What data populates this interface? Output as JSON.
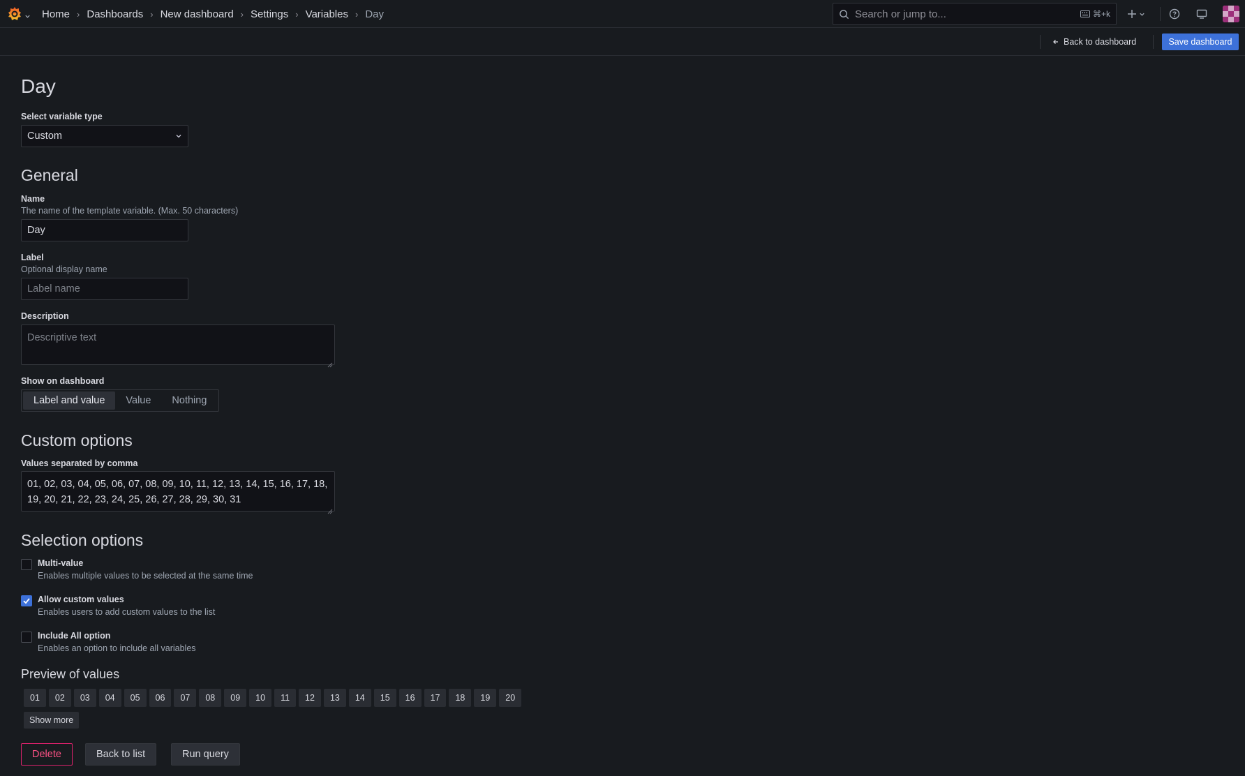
{
  "nav": {
    "breadcrumbs": [
      "Home",
      "Dashboards",
      "New dashboard",
      "Settings",
      "Variables",
      "Day"
    ],
    "separator": "›",
    "search_placeholder": "Search or jump to...",
    "search_shortcut": "⌘+k"
  },
  "toolbar": {
    "back_label": "Back to dashboard",
    "save_label": "Save dashboard"
  },
  "page": {
    "title": "Day"
  },
  "type_select": {
    "label": "Select variable type",
    "value": "Custom"
  },
  "general": {
    "heading": "General",
    "name_label": "Name",
    "name_desc": "The name of the template variable. (Max. 50 characters)",
    "name_value": "Day",
    "label_label": "Label",
    "label_desc": "Optional display name",
    "label_placeholder": "Label name",
    "description_label": "Description",
    "description_placeholder": "Descriptive text",
    "show_label": "Show on dashboard",
    "show_options": [
      "Label and value",
      "Value",
      "Nothing"
    ],
    "show_selected": "Label and value"
  },
  "custom": {
    "heading": "Custom options",
    "values_label": "Values separated by comma",
    "values_line1": "01, 02, 03, 04, 05, 06, 07, 08, 09, 10, 11, 12, 13, 14, 15, 16, 17, 18,",
    "values_line2": "19, 20, 21, 22, 23, 24, 25, 26, 27, 28, 29, 30, 31"
  },
  "selection": {
    "heading": "Selection options",
    "options": [
      {
        "title": "Multi-value",
        "desc": "Enables multiple values to be selected at the same time",
        "checked": false
      },
      {
        "title": "Allow custom values",
        "desc": "Enables users to add custom values to the list",
        "checked": true
      },
      {
        "title": "Include All option",
        "desc": "Enables an option to include all variables",
        "checked": false
      }
    ]
  },
  "preview": {
    "heading": "Preview of values",
    "values": [
      "01",
      "02",
      "03",
      "04",
      "05",
      "06",
      "07",
      "08",
      "09",
      "10",
      "11",
      "12",
      "13",
      "14",
      "15",
      "16",
      "17",
      "18",
      "19",
      "20"
    ],
    "show_more": "Show more"
  },
  "actions": {
    "delete": "Delete",
    "back": "Back to list",
    "run": "Run query"
  },
  "colors": {
    "background": "#181b1f",
    "primary": "#3d71d9",
    "danger": "#e0226e"
  }
}
